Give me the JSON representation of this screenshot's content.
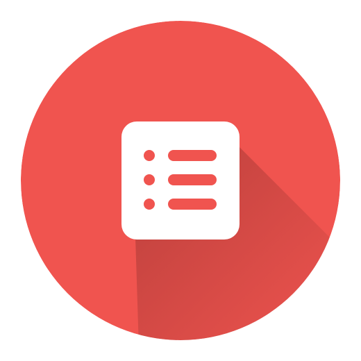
{
  "icon": {
    "name": "list-icon",
    "background_color": "#F0544F",
    "tile_color": "#FFFFFF",
    "glyph_color": "#F0544F",
    "shadow_color": "#8E2F2C",
    "row_count": 3
  }
}
